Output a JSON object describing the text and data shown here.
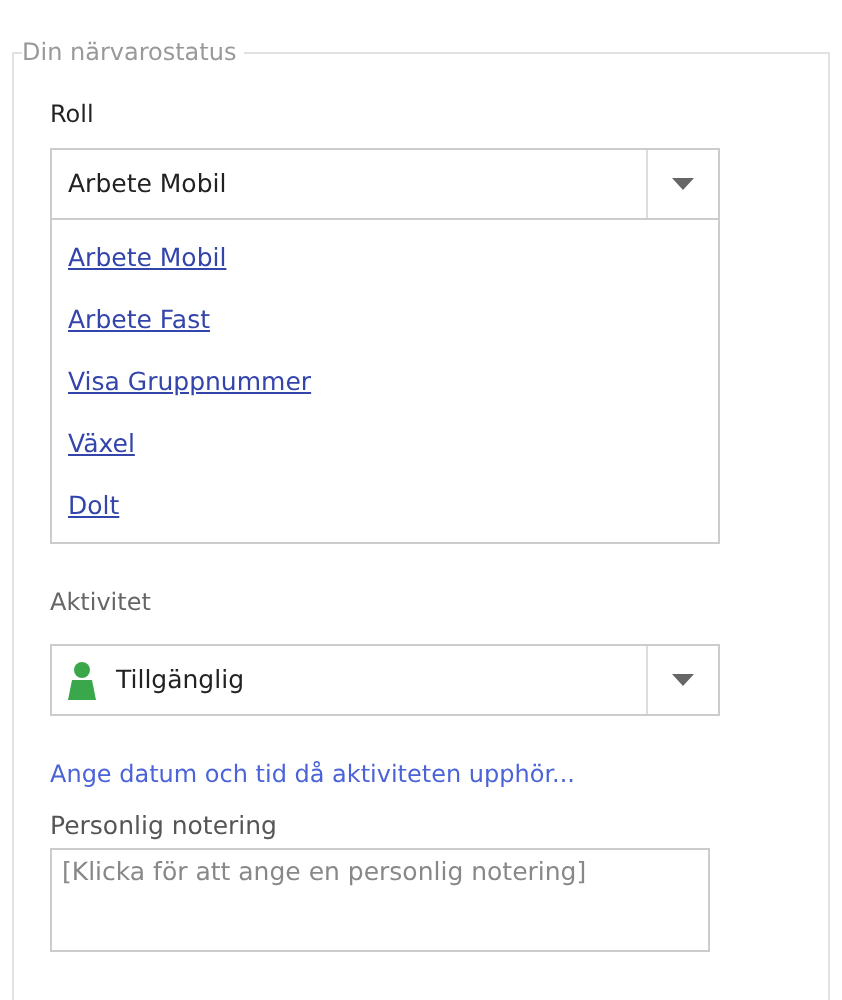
{
  "group": {
    "legend": "Din närvarostatus"
  },
  "role": {
    "label": "Roll",
    "value": "Arbete Mobil",
    "expanded": true,
    "options": [
      "Arbete Mobil",
      "Arbete Fast",
      "Visa Gruppnummer",
      "Växel",
      "Dolt"
    ]
  },
  "activity": {
    "label": "Aktivitet",
    "value": "Tillgänglig",
    "color": "#3aa84a"
  },
  "end_time_link": "Ange datum och tid då aktiviteten upphör...",
  "note": {
    "label": "Personlig notering",
    "placeholder": "[Klicka för att ange en personlig notering]"
  }
}
